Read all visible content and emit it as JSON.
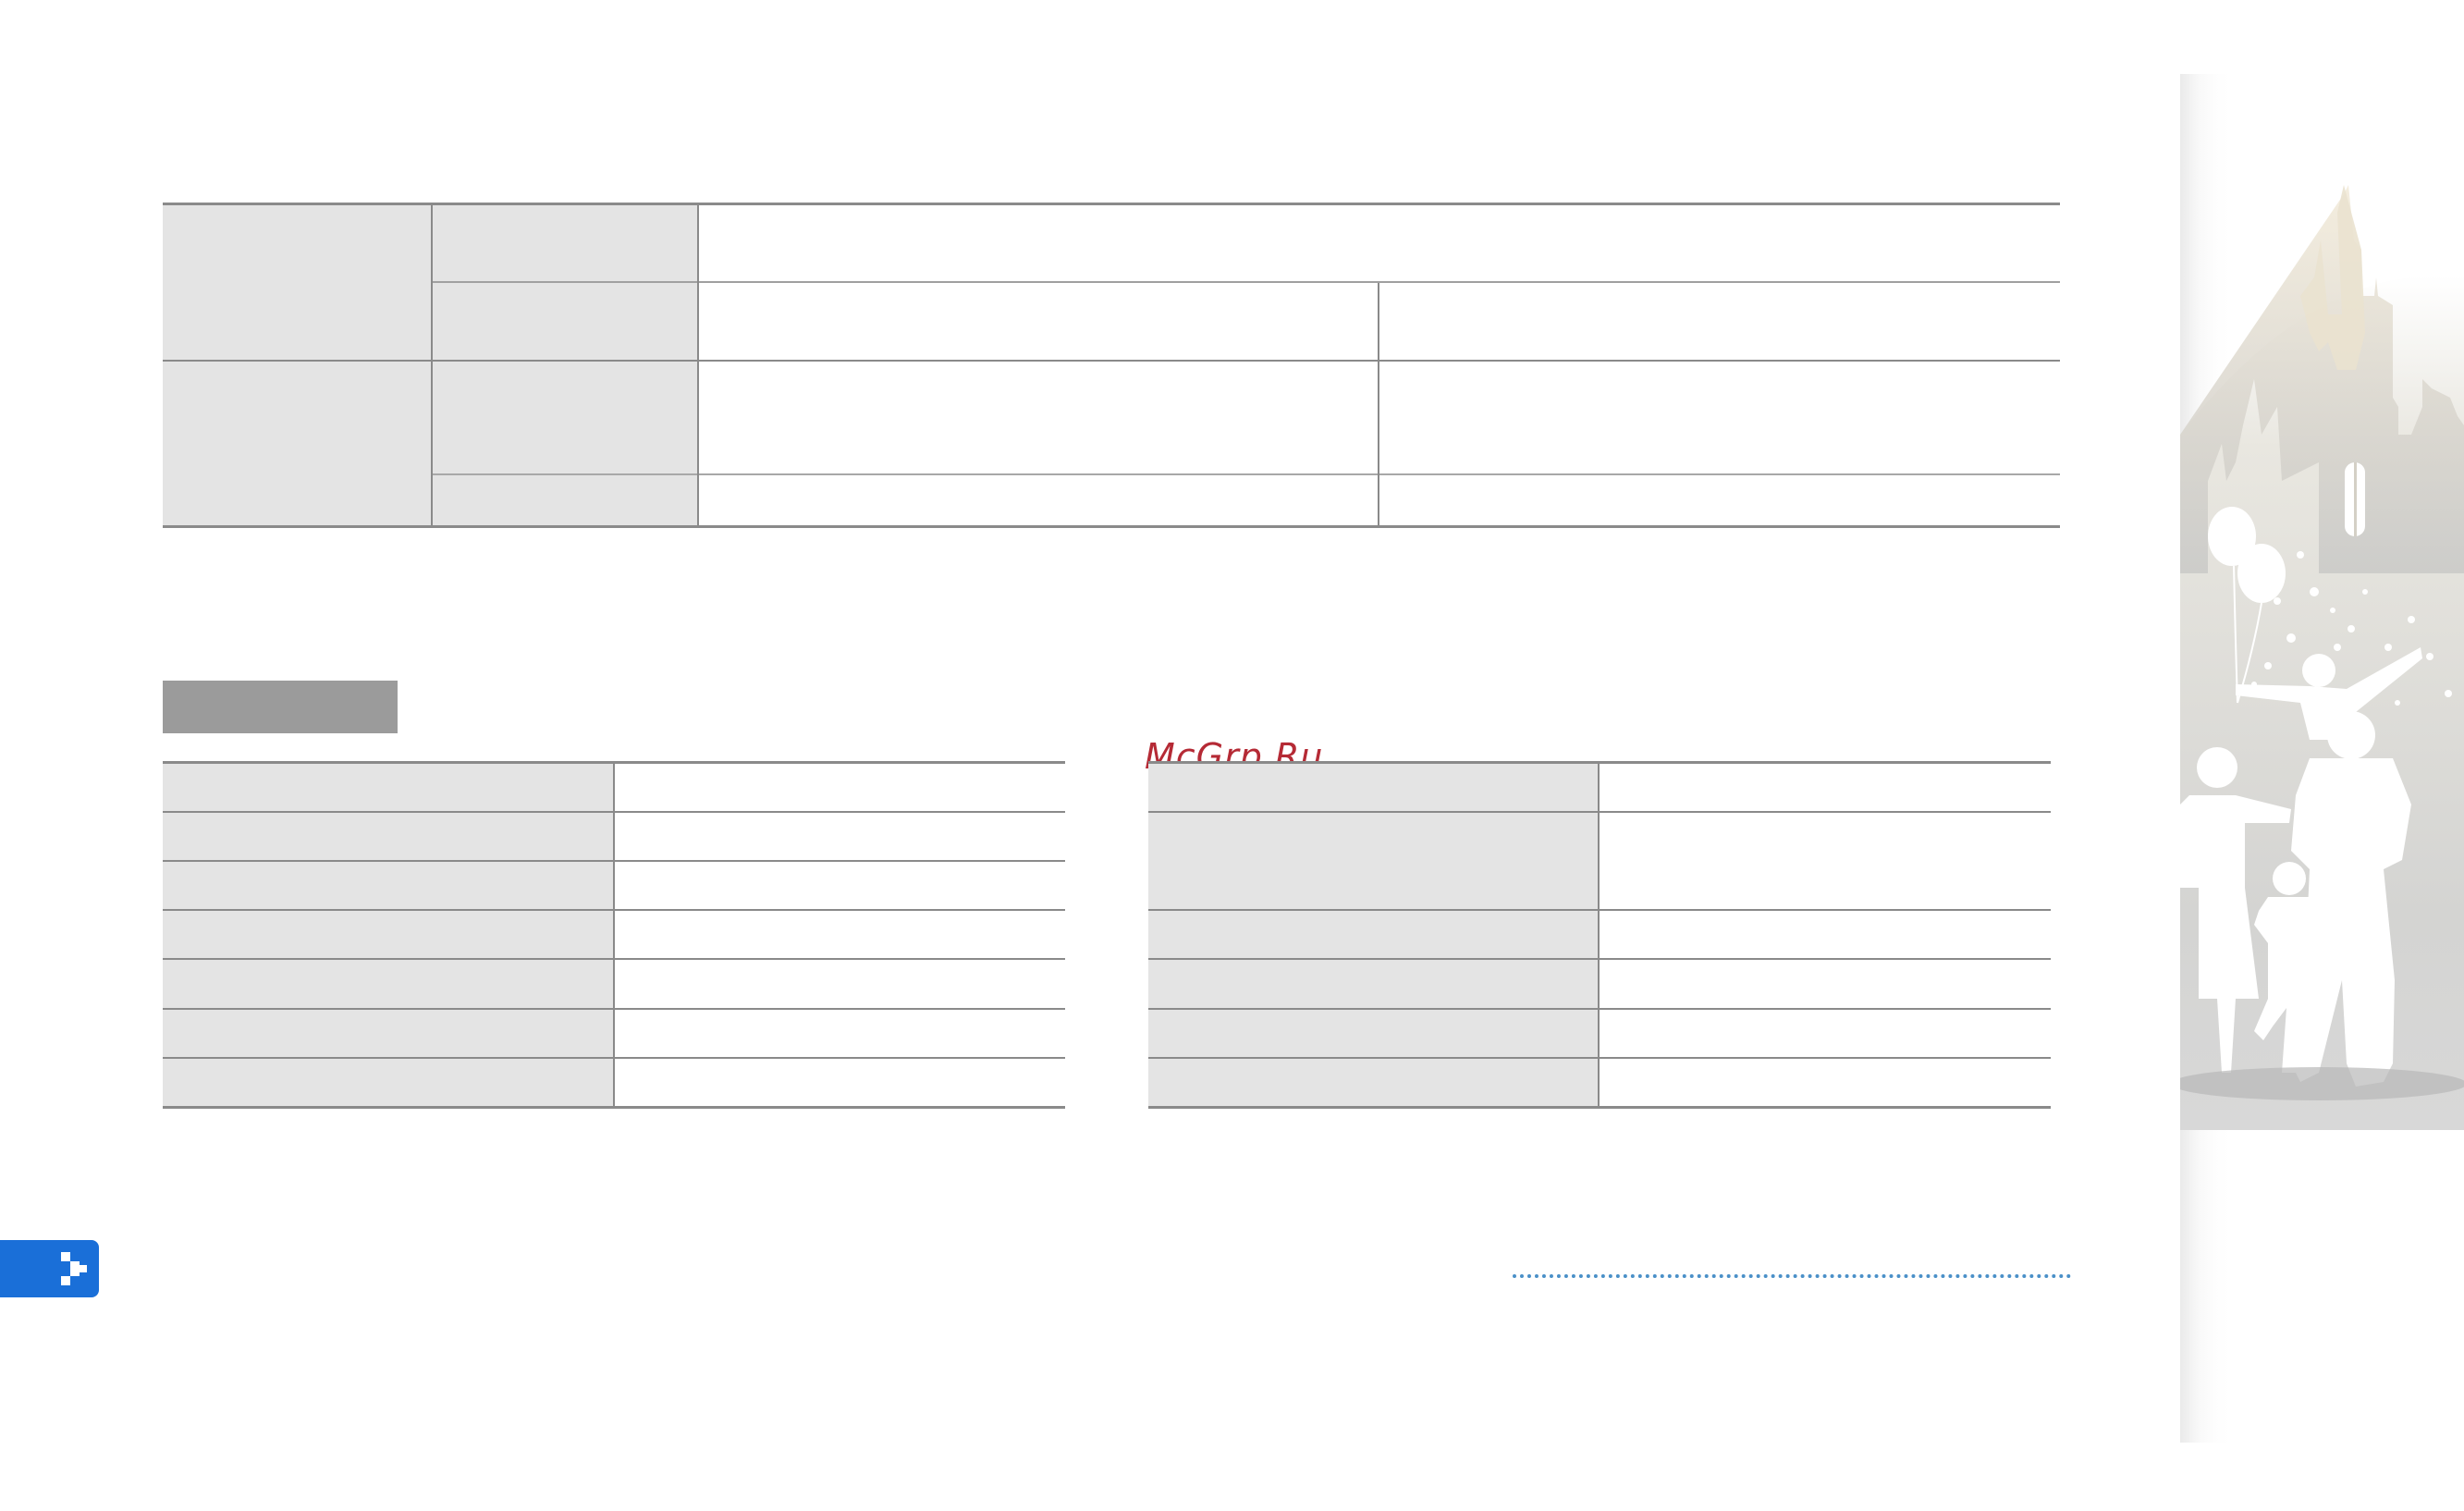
{
  "watermark": {
    "text": "McGrp.Ru"
  },
  "colors": {
    "accent_blue": "#1a6fd8",
    "header_gray": "#e4e4e4",
    "section_bar_gray": "#9b9b9b",
    "rule_gray": "#8a8a8a",
    "watermark_red": "#b52a35"
  },
  "icons": {
    "page_tab": "arrow-right-icon",
    "side_art": "castle-family-silhouette-illustration"
  }
}
